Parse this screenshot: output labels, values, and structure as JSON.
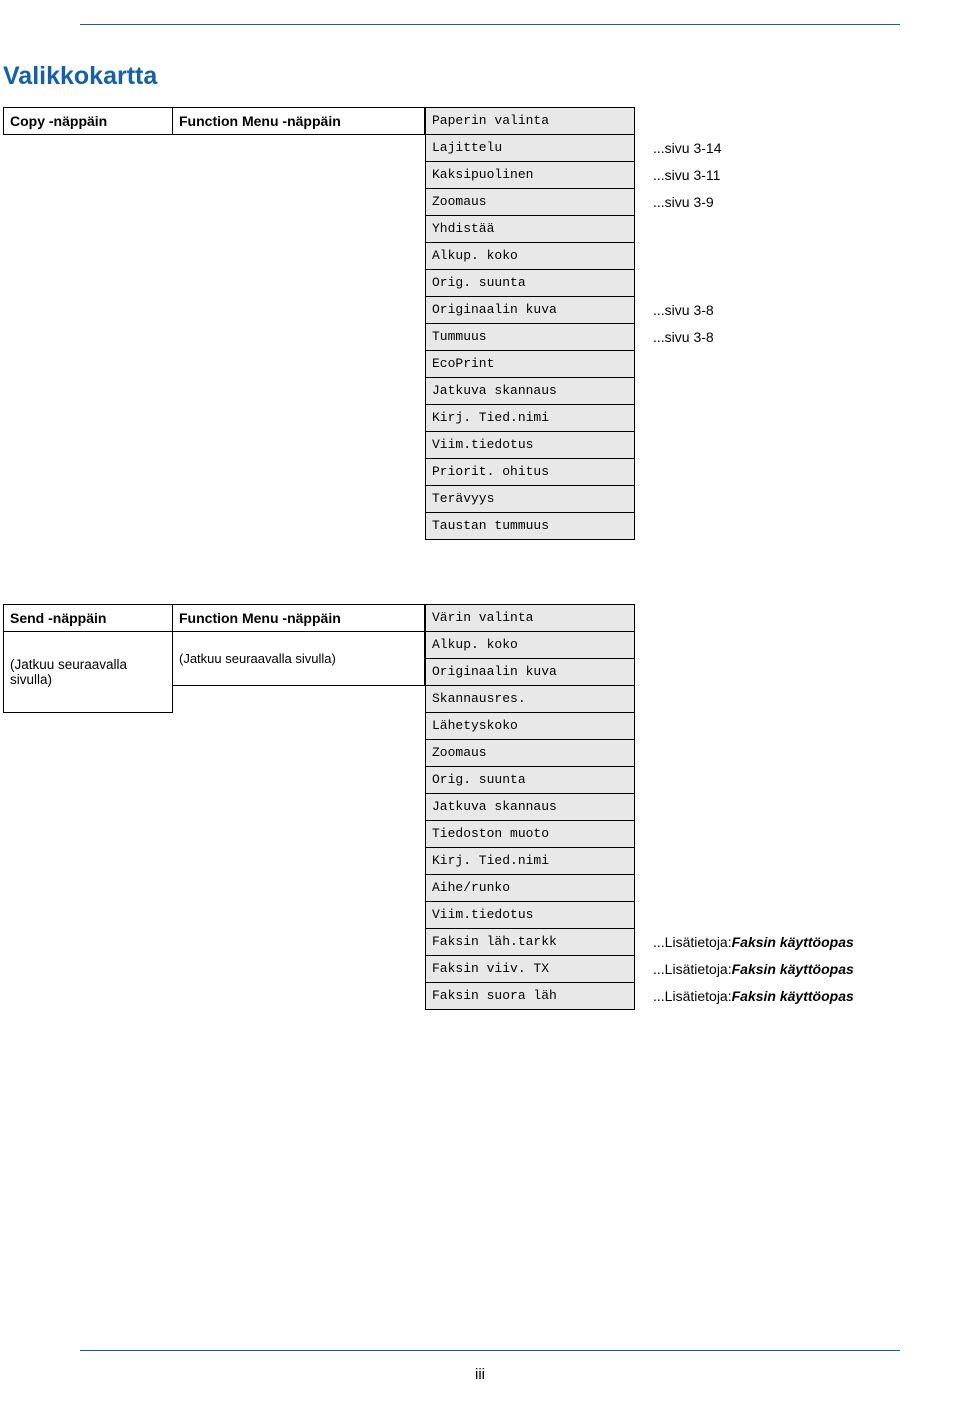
{
  "title": "Valikkokartta",
  "block1": {
    "left_header": "Copy -näppäin",
    "mid_header": "Function Menu -näppäin",
    "menu": [
      "Paperin valinta",
      "Lajittelu",
      "Kaksipuolinen",
      "Zoomaus",
      "Yhdistää",
      "Alkup. koko",
      "Orig. suunta",
      "Originaalin kuva",
      "Tummuus",
      "EcoPrint",
      "Jatkuva skannaus",
      "Kirj. Tied.nimi",
      "Viim.tiedotus",
      "Priorit. ohitus",
      "Terävyys",
      "Taustan tummuus"
    ],
    "notes": [
      "",
      "...sivu 3-14",
      "...sivu 3-11",
      "...sivu 3-9",
      "",
      "",
      "",
      "...sivu 3-8",
      "...sivu 3-8",
      "",
      "",
      "",
      "",
      "",
      "",
      ""
    ]
  },
  "block2": {
    "left_header": "Send -näppäin",
    "mid_header": "Function Menu -näppäin",
    "menu": [
      "Värin valinta",
      "Alkup. koko",
      "Originaalin kuva",
      "Skannausres.",
      "Lähetyskoko",
      "Zoomaus",
      "Orig. suunta",
      "Jatkuva skannaus",
      "Tiedoston muoto",
      "Kirj. Tied.nimi",
      "Aihe/runko",
      "Viim.tiedotus",
      "Faksin läh.tarkk",
      "Faksin viiv. TX",
      "Faksin suora läh"
    ],
    "notes_pre": "...Lisätietoja: ",
    "notes_em": "Faksin käyttöopas",
    "left_cont": "(Jatkuu seuraavalla sivulla)",
    "mid_cont": "(Jatkuu seuraavalla sivulla)"
  },
  "page_number": "iii"
}
